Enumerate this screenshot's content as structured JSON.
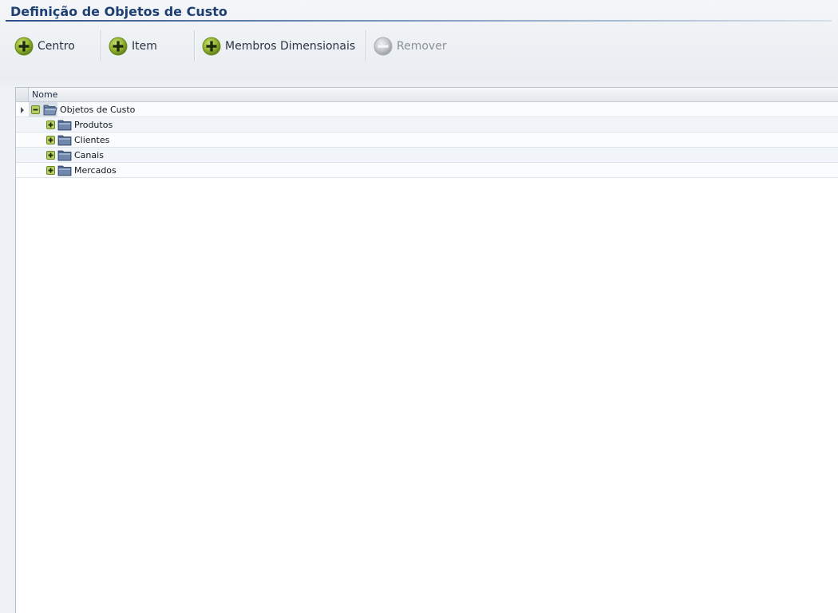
{
  "window": {
    "title": "Definição de Objetos de Custo"
  },
  "toolbar": {
    "buttons": [
      {
        "label": "Centro",
        "icon": "add-circle-icon",
        "enabled": true
      },
      {
        "label": "Item",
        "icon": "add-circle-icon",
        "enabled": true
      },
      {
        "label": "Membros Dimensionais",
        "icon": "add-circle-icon",
        "enabled": true
      },
      {
        "label": "Remover",
        "icon": "remove-circle-icon",
        "enabled": false
      }
    ]
  },
  "grid": {
    "columns": [
      "Nome"
    ],
    "rows": [
      {
        "label": "Objetos de Custo",
        "level": 0,
        "expanded": true,
        "icon": "folder-open-icon",
        "current": true
      },
      {
        "label": "Produtos",
        "level": 1,
        "expanded": false,
        "icon": "folder-icon"
      },
      {
        "label": "Clientes",
        "level": 1,
        "expanded": false,
        "icon": "folder-icon"
      },
      {
        "label": "Canais",
        "level": 1,
        "expanded": false,
        "icon": "folder-icon"
      },
      {
        "label": "Mercados",
        "level": 1,
        "expanded": false,
        "icon": "folder-icon"
      }
    ]
  },
  "colors": {
    "title": "#1f3f73",
    "add_icon": "#8fb32e",
    "remove_icon": "#b8bcc2",
    "folder": "#3d5a86"
  }
}
